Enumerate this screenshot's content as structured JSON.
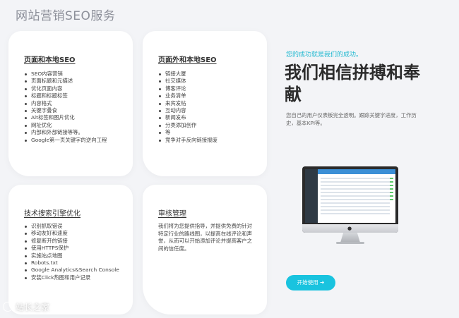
{
  "page": {
    "title": "网站营销SEO服务"
  },
  "cards": {
    "onpage": {
      "title": "页面和本地SEO",
      "items": [
        "SEO内容营销",
        "页面标题和元描述",
        "优化页面内容",
        "标题和标题标签",
        "内容格式",
        "关键字叠食",
        "Alt标签和图片优化",
        "网址优化",
        "内部和外部链接等等。",
        "Google第一页关键字的逆向工程"
      ]
    },
    "offpage": {
      "title": "页面外和本地SEO",
      "items": [
        "链接大厦",
        "社交媒体",
        "博客评论",
        "业务清单",
        "来宾发帖",
        "互动内容",
        "新闻发布",
        "分类添加创作",
        "等",
        "竞争对手反向链接报废"
      ]
    },
    "technical": {
      "title": "技术搜索引擎优化",
      "items": [
        "识别抓取错误",
        "移动友好和速度",
        "修复断开的链接",
        "使用HTTPS保护",
        "实施站点地图",
        "Robots.txt",
        "Google Analytics&Search Console",
        "安装Click热图和用户记录"
      ]
    },
    "audit": {
      "title": "审核管理",
      "text": "我们将为您提供指导，并提供免费的针对特定行业的路线图，以提高在线评论和声誉，从而可以开始添加评论并提高客户之间的信任度。"
    }
  },
  "hero": {
    "tagline": "您的成功就是我们的成功。",
    "headline": "我们相信拼搏和奉献",
    "description": "您自己的用户仪表板完全透明。跟踪关键字进度，工作历史，基本KPI等。",
    "cta_label": "开始使用 ➔"
  },
  "watermark": {
    "text": "站长之家"
  },
  "colors": {
    "accent": "#19c3df",
    "background": "#f3f4f7",
    "card": "#ffffff"
  }
}
